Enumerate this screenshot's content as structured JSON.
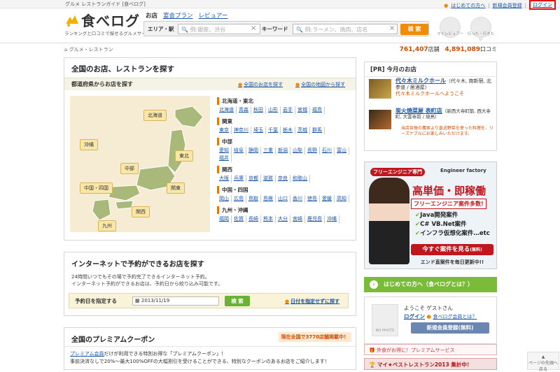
{
  "topbar": {
    "tagline": "グルメ レストランガイド [食べログ]",
    "first_time": "はじめての方へ",
    "register": "新規会員登録",
    "login": "ログイン"
  },
  "header": {
    "logo_text": "食べログ",
    "logo_sub": "ランキングと口コミで探せるグルメサイト",
    "tabs": [
      "お店",
      "宴会プラン",
      "レビュアー"
    ],
    "area_label": "エリア・駅",
    "area_placeholder": "例:銀座、渋谷",
    "keyword_label": "キーワード",
    "keyword_placeholder": "例:ラーメン、焼肉、店名",
    "search_button": "検 索",
    "my_reviewer": "マイレビュアー",
    "saved": "行った・行きたい"
  },
  "breadcrumb": "グルメ・レストラン",
  "stats": {
    "shops": "761,407",
    "shops_unit": "店舗",
    "reviews": "4,891,089",
    "reviews_unit": "口コミ"
  },
  "main": {
    "title": "全国のお店、レストランを探す",
    "pref_label": "都道府県からお店を探す",
    "all_shops_link": "全国のお店を探す",
    "map_link": "全国の地図から探す",
    "map_regions": [
      "北海道",
      "東北",
      "沖縄",
      "中部",
      "関東",
      "中国・四国",
      "関西",
      "九州"
    ],
    "regions": [
      {
        "title": "北海道・東北",
        "prefs": [
          "北海道",
          "青森",
          "秋田",
          "山形",
          "岩手",
          "宮城",
          "福島"
        ]
      },
      {
        "title": "関東",
        "prefs": [
          "東京",
          "神奈川",
          "埼玉",
          "千葉",
          "栃木",
          "茨城",
          "群馬"
        ]
      },
      {
        "title": "中部",
        "prefs": [
          "愛知",
          "岐阜",
          "静岡",
          "三重",
          "新潟",
          "山梨",
          "長野",
          "石川",
          "富山",
          "福井"
        ]
      },
      {
        "title": "関西",
        "prefs": [
          "大阪",
          "兵庫",
          "京都",
          "滋賀",
          "奈良",
          "和歌山"
        ]
      },
      {
        "title": "中国・四国",
        "prefs": [
          "岡山",
          "広島",
          "鳥取",
          "島根",
          "山口",
          "香川",
          "徳島",
          "愛媛",
          "高知"
        ]
      },
      {
        "title": "九州・沖縄",
        "prefs": [
          "福岡",
          "佐賀",
          "長崎",
          "熊本",
          "大分",
          "宮崎",
          "鹿児島",
          "沖縄"
        ]
      }
    ]
  },
  "reserve": {
    "title": "インターネットで予約ができるお店を探す",
    "desc1": "24時間いつでもその場で予約完了できるインターネット予約。",
    "desc2": "インターネット予約ができるお店は、予約日から絞り込み可能です。",
    "date_label": "予約日を指定する",
    "date_value": "2013/11/19",
    "search_button": "検 索",
    "no_date_link": "日付を指定せずに探す"
  },
  "coupon": {
    "title": "全国のプレミアムクーポン",
    "badge": "現在全国で3770店舗掲載中！",
    "line1_link": "プレミアム会員",
    "line1": "だけが利用できる特別お得な「プレミアムクーポン」！",
    "line2": "事前決済なしで20%〜最大100%OFFの大幅割引を受けることができる、特別なクーポンのあるお店をご紹介します！"
  },
  "pr": {
    "title": "[PR] 今月のお店",
    "item1_name": "代々木ミルクホール",
    "item1_info": "（代々木, 南新宿, 北参道 / 居酒屋）",
    "item1_sub": "代々木ミルクホールへようこそ",
    "item2_name": "炭火焼菜屋 表町店",
    "item2_info": "（新西大寺町筋, 西大寺町, 大雲寺前 / 焼鳥）",
    "item2_sub": "当店自慢の農家より直送野菜を使った料理を、リーズナブルにお楽しみいただけます。"
  },
  "ad": {
    "brand1": "フリーエンジニア専門",
    "brand2": "Engineer factory",
    "headline": "高単価・即稼働",
    "subline": "フリーエンジニア案件多数!",
    "items": [
      "Java開発案件",
      "C# VB.Net案件",
      "インフラ仮想化案件…etc"
    ],
    "cta": "今すぐ案件を見る",
    "cta_badge": "(無料)",
    "footer": "エンド直案件を毎日更新中!!"
  },
  "sidebar": {
    "intro": "はじめての方へ（食べログとは？）",
    "welcome": "ようこそ ゲストさん",
    "login": "ログイン",
    "login_help": "食べログ会員とは？",
    "register_btn": "新規会員登録(無料)",
    "no_photo": "NO PHOTO",
    "premium": "外食がお得に！プレミアムサービス",
    "best": "マイ★ベストレストラン2013 集計中！",
    "page_top": "ページの先頭へ戻る"
  }
}
